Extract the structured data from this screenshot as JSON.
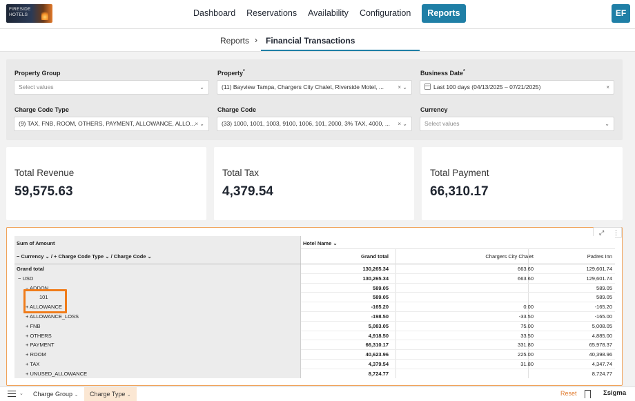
{
  "app": {
    "logo_text": "FIRESIDE\nHOTELS",
    "nav": [
      "Dashboard",
      "Reservations",
      "Availability",
      "Configuration",
      "Reports"
    ],
    "active_nav": "Reports",
    "avatar_initials": "EF"
  },
  "breadcrumb": {
    "parent": "Reports",
    "separator": "›",
    "current": "Financial Transactions"
  },
  "filters": {
    "property_group": {
      "label": "Property Group",
      "placeholder": "Select values"
    },
    "property": {
      "label": "Property",
      "required": "*",
      "value": "(11) Bayview Tampa, Chargers City Chalet, Riverside Motel, ..."
    },
    "business_date": {
      "label": "Business Date",
      "required": "*",
      "value": "Last 100 days (04/13/2025 – 07/21/2025)"
    },
    "charge_code_type": {
      "label": "Charge Code Type",
      "value": "(9) TAX, FNB, ROOM, OTHERS, PAYMENT, ALLOWANCE, ALLO..."
    },
    "charge_code": {
      "label": "Charge Code",
      "value": "(33) 1000, 1001, 1003, 9100, 1006, 101, 2000, 3% TAX, 4000, ..."
    },
    "currency": {
      "label": "Currency",
      "placeholder": "Select values"
    }
  },
  "kpis": [
    {
      "title": "Total Revenue",
      "value": "59,575.63"
    },
    {
      "title": "Total Tax",
      "value": "4,379.54"
    },
    {
      "title": "Total Payment",
      "value": "66,310.17"
    }
  ],
  "pivot": {
    "title": "Sum of Amount",
    "row_fields": "−  Currency  ⌄  /   +  Charge Code Type  ⌄  /   Charge Code  ⌄",
    "column_field": "Hotel Name  ⌄",
    "columns": [
      "Grand total",
      "Chargers City Chalet",
      "Padres Inn"
    ],
    "rows": [
      {
        "label": "Grand total",
        "indent": 0,
        "bold": true,
        "gt": "130,265.34",
        "cc": "663.60",
        "pi": "129,601.74"
      },
      {
        "label": "−  USD",
        "indent": 1,
        "gt": "130,265.34",
        "cc": "663.60",
        "pi": "129,601.74"
      },
      {
        "label": "−  ADDON",
        "indent": 2,
        "gt": "589.05",
        "cc": "",
        "pi": "589.05"
      },
      {
        "label": "101",
        "indent": 3,
        "gt": "589.05",
        "cc": "",
        "pi": "589.05"
      },
      {
        "label": "+  ALLOWANCE",
        "indent": 2,
        "gt": "-165.20",
        "cc": "0.00",
        "pi": "-165.20"
      },
      {
        "label": "+  ALLOWANCE_LOSS",
        "indent": 2,
        "gt": "-198.50",
        "cc": "-33.50",
        "pi": "-165.00"
      },
      {
        "label": "+  FNB",
        "indent": 2,
        "gt": "5,083.05",
        "cc": "75.00",
        "pi": "5,008.05"
      },
      {
        "label": "+  OTHERS",
        "indent": 2,
        "gt": "4,918.50",
        "cc": "33.50",
        "pi": "4,885.00"
      },
      {
        "label": "+  PAYMENT",
        "indent": 2,
        "gt": "66,310.17",
        "cc": "331.80",
        "pi": "65,978.37"
      },
      {
        "label": "+  ROOM",
        "indent": 2,
        "gt": "40,623.96",
        "cc": "225.00",
        "pi": "40,398.96"
      },
      {
        "label": "+  TAX",
        "indent": 2,
        "gt": "4,379.54",
        "cc": "31.80",
        "pi": "4,347.74"
      },
      {
        "label": "+  UNUSED_ALLOWANCE",
        "indent": 2,
        "gt": "8,724.77",
        "cc": "",
        "pi": "8,724.77"
      }
    ]
  },
  "bottom": {
    "tabs": [
      "Charge Group",
      "Charge Type"
    ],
    "active_tab": "Charge Type",
    "reset_label": "Reset",
    "brand": "sigma"
  },
  "colors": {
    "accent": "#1f7fa6",
    "highlight": "#f07c1a",
    "panel": "#e9e9e9"
  }
}
